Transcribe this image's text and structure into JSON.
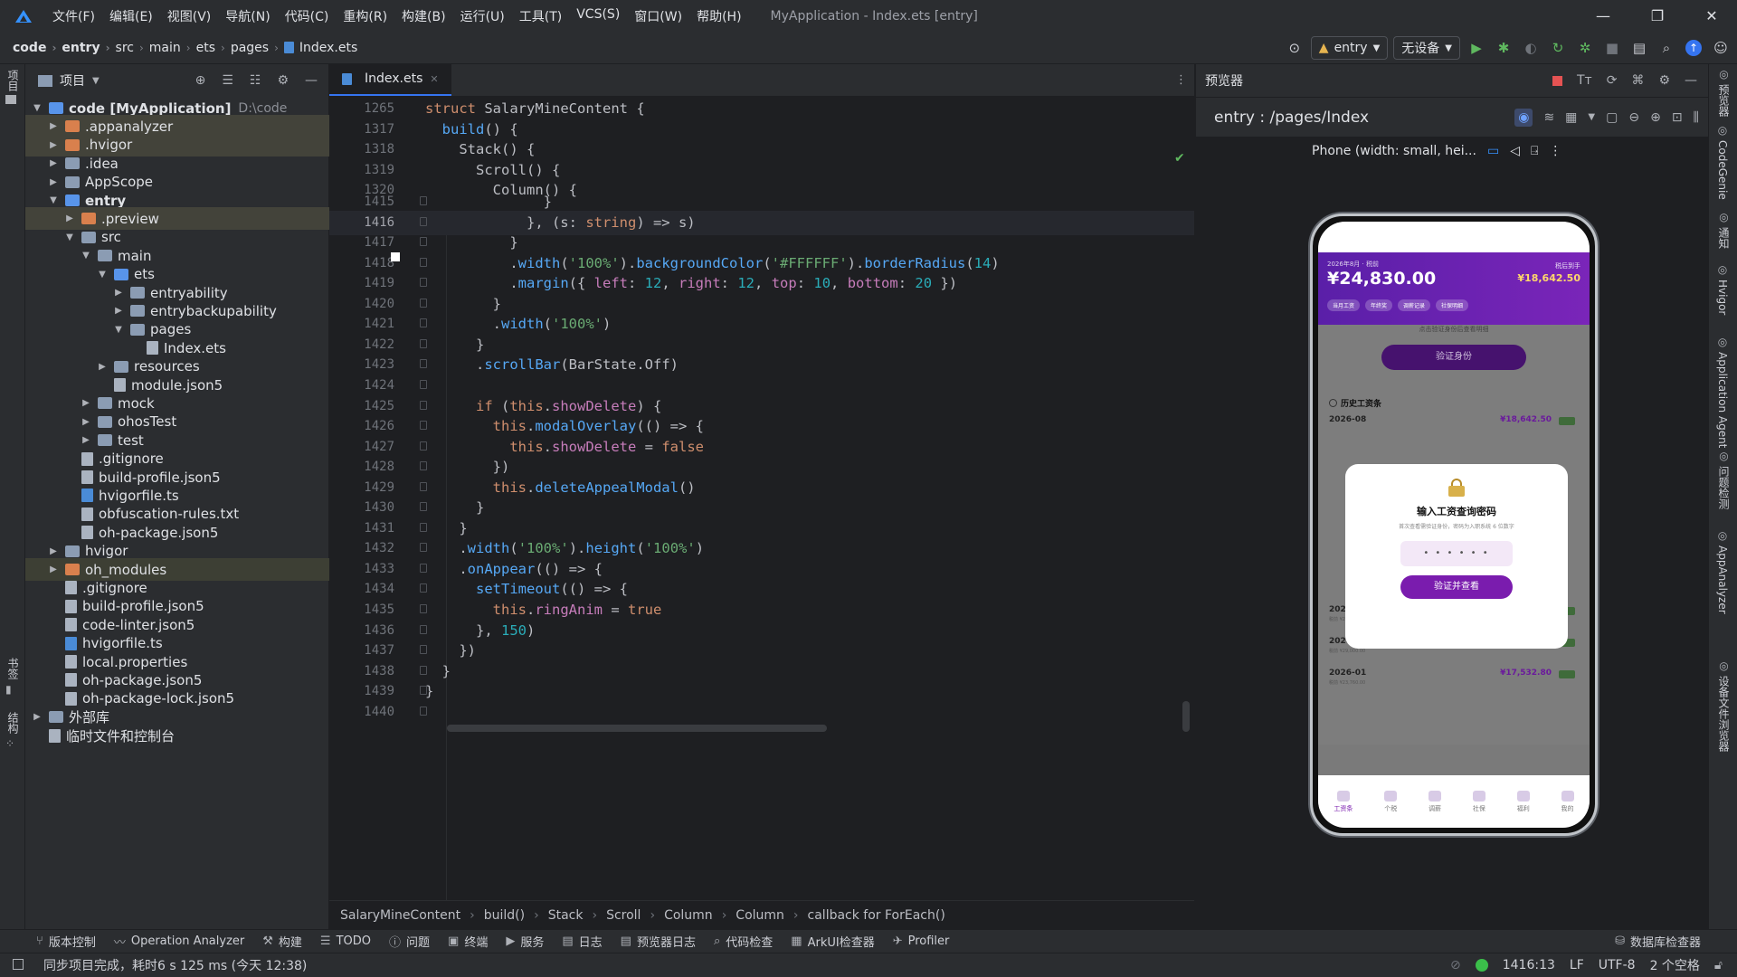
{
  "menubar": {
    "items": [
      "文件(F)",
      "编辑(E)",
      "视图(V)",
      "导航(N)",
      "代码(C)",
      "重构(R)",
      "构建(B)",
      "运行(U)",
      "工具(T)",
      "VCS(S)",
      "窗口(W)",
      "帮助(H)"
    ],
    "title": "MyApplication - Index.ets [entry]"
  },
  "navbar": {
    "crumbs": [
      "code",
      "entry",
      "src",
      "main",
      "ets",
      "pages",
      "Index.ets"
    ],
    "run_config": "entry",
    "device": "无设备"
  },
  "project": {
    "title": "项目",
    "rows": [
      {
        "label": "code [MyApplication]",
        "extra": "D:\\code",
        "level": 0,
        "arrow": "down",
        "icon": "fold-b"
      },
      {
        "label": ".appanalyzer",
        "level": 1,
        "arrow": "right",
        "icon": "fold-o"
      },
      {
        "label": ".hvigor",
        "level": 1,
        "arrow": "right",
        "icon": "fold-o"
      },
      {
        "label": ".idea",
        "level": 1,
        "arrow": "right",
        "icon": "fold"
      },
      {
        "label": "AppScope",
        "level": 1,
        "arrow": "right",
        "icon": "fold"
      },
      {
        "label": "entry",
        "level": 1,
        "arrow": "down",
        "icon": "fold-b"
      },
      {
        "label": ".preview",
        "level": 2,
        "arrow": "right",
        "icon": "fold-o"
      },
      {
        "label": "src",
        "level": 2,
        "arrow": "down",
        "icon": "fold"
      },
      {
        "label": "main",
        "level": 3,
        "arrow": "down",
        "icon": "fold"
      },
      {
        "label": "ets",
        "level": 4,
        "arrow": "down",
        "icon": "fold-b"
      },
      {
        "label": "entryability",
        "level": 5,
        "arrow": "right",
        "icon": "fold"
      },
      {
        "label": "entrybackupability",
        "level": 5,
        "arrow": "right",
        "icon": "fold"
      },
      {
        "label": "pages",
        "level": 5,
        "arrow": "down",
        "icon": "fold"
      },
      {
        "label": "Index.ets",
        "level": 6,
        "arrow": "",
        "icon": "file"
      },
      {
        "label": "resources",
        "level": 4,
        "arrow": "right",
        "icon": "fold"
      },
      {
        "label": "module.json5",
        "level": 4,
        "arrow": "",
        "icon": "file"
      },
      {
        "label": "mock",
        "level": 3,
        "arrow": "right",
        "icon": "fold"
      },
      {
        "label": "ohosTest",
        "level": 3,
        "arrow": "right",
        "icon": "fold"
      },
      {
        "label": "test",
        "level": 3,
        "arrow": "right",
        "icon": "fold"
      },
      {
        "label": ".gitignore",
        "level": 2,
        "arrow": "",
        "icon": "file"
      },
      {
        "label": "build-profile.json5",
        "level": 2,
        "arrow": "",
        "icon": "file"
      },
      {
        "label": "hvigorfile.ts",
        "level": 2,
        "arrow": "",
        "icon": "file ts"
      },
      {
        "label": "obfuscation-rules.txt",
        "level": 2,
        "arrow": "",
        "icon": "file"
      },
      {
        "label": "oh-package.json5",
        "level": 2,
        "arrow": "",
        "icon": "file"
      },
      {
        "label": "hvigor",
        "level": 1,
        "arrow": "right",
        "icon": "fold"
      },
      {
        "label": "oh_modules",
        "level": 1,
        "arrow": "right",
        "icon": "fold-o"
      },
      {
        "label": ".gitignore",
        "level": 1,
        "arrow": "",
        "icon": "file"
      },
      {
        "label": "build-profile.json5",
        "level": 1,
        "arrow": "",
        "icon": "file"
      },
      {
        "label": "code-linter.json5",
        "level": 1,
        "arrow": "",
        "icon": "file"
      },
      {
        "label": "hvigorfile.ts",
        "level": 1,
        "arrow": "",
        "icon": "file ts"
      },
      {
        "label": "local.properties",
        "level": 1,
        "arrow": "",
        "icon": "file"
      },
      {
        "label": "oh-package.json5",
        "level": 1,
        "arrow": "",
        "icon": "file"
      },
      {
        "label": "oh-package-lock.json5",
        "level": 1,
        "arrow": "",
        "icon": "file"
      },
      {
        "label": "外部库",
        "level": 0,
        "arrow": "right",
        "icon": "fold"
      },
      {
        "label": "临时文件和控制台",
        "level": 0,
        "arrow": "",
        "icon": "file"
      }
    ]
  },
  "editor": {
    "tab": "Index.ets",
    "sticky": [
      {
        "ln": "1265",
        "code": "struct SalaryMineContent {"
      },
      {
        "ln": "1317",
        "code": "  build() {"
      },
      {
        "ln": "1318",
        "code": "    Stack() {"
      },
      {
        "ln": "1319",
        "code": "      Scroll() {"
      },
      {
        "ln": "1320",
        "code": "        Column() {"
      }
    ],
    "lines": [
      {
        "ln": "1415",
        "code": "              }"
      },
      {
        "ln": "1416",
        "code": "            }, (s: string) => s)"
      },
      {
        "ln": "1417",
        "code": "          }"
      },
      {
        "ln": "1418",
        "code": "          .width('100%').backgroundColor('#FFFFFF').borderRadius(14)"
      },
      {
        "ln": "1419",
        "code": "          .margin({ left: 12, right: 12, top: 10, bottom: 20 })"
      },
      {
        "ln": "1420",
        "code": "        }"
      },
      {
        "ln": "1421",
        "code": "        .width('100%')"
      },
      {
        "ln": "1422",
        "code": "      }"
      },
      {
        "ln": "1423",
        "code": "      .scrollBar(BarState.Off)"
      },
      {
        "ln": "1424",
        "code": ""
      },
      {
        "ln": "1425",
        "code": "      if (this.showDelete) {"
      },
      {
        "ln": "1426",
        "code": "        this.modalOverlay(() => {"
      },
      {
        "ln": "1427",
        "code": "          this.showDelete = false"
      },
      {
        "ln": "1428",
        "code": "        })"
      },
      {
        "ln": "1429",
        "code": "        this.deleteAppealModal()"
      },
      {
        "ln": "1430",
        "code": "      }"
      },
      {
        "ln": "1431",
        "code": "    }"
      },
      {
        "ln": "1432",
        "code": "    .width('100%').height('100%')"
      },
      {
        "ln": "1433",
        "code": "    .onAppear(() => {"
      },
      {
        "ln": "1434",
        "code": "      setTimeout(() => {"
      },
      {
        "ln": "1435",
        "code": "        this.ringAnim = true"
      },
      {
        "ln": "1436",
        "code": "      }, 150)"
      },
      {
        "ln": "1437",
        "code": "    })"
      },
      {
        "ln": "1438",
        "code": "  }"
      },
      {
        "ln": "1439",
        "code": "}"
      },
      {
        "ln": "1440",
        "code": ""
      }
    ],
    "current_line": "1416",
    "breadcrumbs": [
      "SalaryMineContent",
      "build()",
      "Stack",
      "Scroll",
      "Column",
      "Column",
      "callback for ForEach()"
    ]
  },
  "preview": {
    "title": "预览器",
    "route": "entry : /pages/Index",
    "device_label": "Phone (width: small, hei...",
    "app": {
      "banner_sub": "2026年8月 · 税前",
      "amount": "¥24,830.00",
      "right_label": "税后到手",
      "right_amount": "¥18,642.50",
      "chips": [
        "当月工资",
        "年终奖",
        "调薪记录",
        "社保明细"
      ],
      "hint": "点击验证身份后查看明细",
      "verify_btn": "验证身份",
      "history_title": "历史工资条",
      "history": [
        {
          "month": "2026-08",
          "amount": "¥18,642.50"
        },
        {
          "month": "2026-03",
          "amount": "¥17,532.80",
          "sub": "税前 ¥23,760.00"
        },
        {
          "month": "2026-02",
          "amount": "¥21,204.60",
          "sub": "税前 ¥29,000.00"
        },
        {
          "month": "2026-01",
          "amount": "¥17,532.80",
          "sub": "税前 ¥23,760.00"
        }
      ],
      "modal_title": "输入工资查询密码",
      "modal_desc": "首次查看需验证身份，密码为入职系统 6 位数字",
      "modal_dots": "• • • • • •",
      "modal_btn": "验证并查看",
      "nav": [
        "工资条",
        "个税",
        "调薪",
        "社保",
        "福利",
        "我的"
      ]
    }
  },
  "left_strip": {
    "project": "项目",
    "bookmarks": "书签",
    "structure": "结构"
  },
  "right_strip": [
    "预览器",
    "CodeGenie",
    "通知",
    "Hvigor",
    "Application Agent",
    "问题检测",
    "AppAnalyzer",
    "设备文件浏览器"
  ],
  "bottom_tools": [
    "版本控制",
    "Operation Analyzer",
    "构建",
    "TODO",
    "问题",
    "终端",
    "服务",
    "日志",
    "预览器日志",
    "代码检查",
    "ArkUI检查器",
    "Profiler"
  ],
  "bottom_right_tool": "数据库检查器",
  "status": {
    "message": "同步项目完成，耗时6 s 125 ms (今天 12:38)",
    "position": "1416:13",
    "eol": "LF",
    "encoding": "UTF-8",
    "indent": "2 个空格"
  }
}
